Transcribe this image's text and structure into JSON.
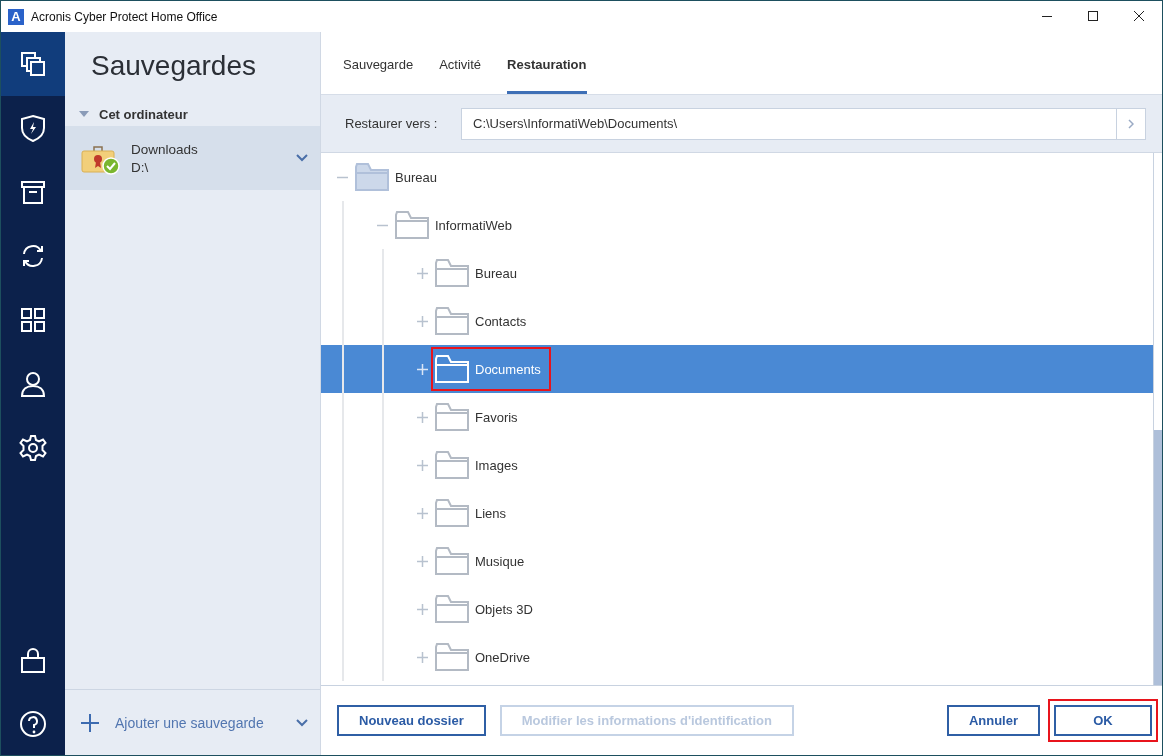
{
  "window": {
    "logo_letter": "A",
    "title": "Acronis Cyber Protect Home Office"
  },
  "nav_items": [
    {
      "selected": true
    },
    {
      "selected": false
    },
    {
      "selected": false
    },
    {
      "selected": false
    },
    {
      "selected": false
    },
    {
      "selected": false
    },
    {
      "selected": false
    }
  ],
  "nav_bottom_items": [
    {
      "selected": false
    },
    {
      "selected": false
    }
  ],
  "backups_panel": {
    "title": "Sauvegardes",
    "section": {
      "label": "Cet ordinateur",
      "expanded": true
    },
    "items": [
      {
        "name": "Downloads",
        "path": "D:\\",
        "backed_up": true,
        "selected": true
      }
    ],
    "add_button": "Ajouter une sauvegarde"
  },
  "tabs": [
    {
      "label": "Sauvegarde",
      "selected": false
    },
    {
      "label": "Activité",
      "selected": false
    },
    {
      "label": "Restauration",
      "selected": true
    }
  ],
  "restore_to": {
    "label": "Restaurer vers :",
    "value": "C:\\Users\\InformatiWeb\\Documents\\"
  },
  "tree": [
    {
      "label": "Bureau",
      "expanded": true,
      "selected": false,
      "highlighted": false,
      "children": [
        {
          "label": "InformatiWeb",
          "expanded": true,
          "selected": false,
          "highlighted": false,
          "children": [
            {
              "label": "Bureau",
              "expanded": false,
              "selected": false,
              "highlighted": false
            },
            {
              "label": "Contacts",
              "expanded": false,
              "selected": false,
              "highlighted": false
            },
            {
              "label": "Documents",
              "expanded": false,
              "selected": true,
              "highlighted": true
            },
            {
              "label": "Favoris",
              "expanded": false,
              "selected": false,
              "highlighted": false
            },
            {
              "label": "Images",
              "expanded": false,
              "selected": false,
              "highlighted": false
            },
            {
              "label": "Liens",
              "expanded": false,
              "selected": false,
              "highlighted": false
            },
            {
              "label": "Musique",
              "expanded": false,
              "selected": false,
              "highlighted": false
            },
            {
              "label": "Objets 3D",
              "expanded": false,
              "selected": false,
              "highlighted": false
            },
            {
              "label": "OneDrive",
              "expanded": false,
              "selected": false,
              "highlighted": false
            }
          ]
        }
      ]
    }
  ],
  "buttons": [
    {
      "label": "Nouveau dossier",
      "disabled": false,
      "highlighted": false
    },
    {
      "label": "Modifier les informations d'identification",
      "disabled": true,
      "highlighted": false
    },
    {
      "label": "Annuler",
      "disabled": false,
      "highlighted": false
    },
    {
      "label": "OK",
      "disabled": false,
      "highlighted": true
    }
  ]
}
